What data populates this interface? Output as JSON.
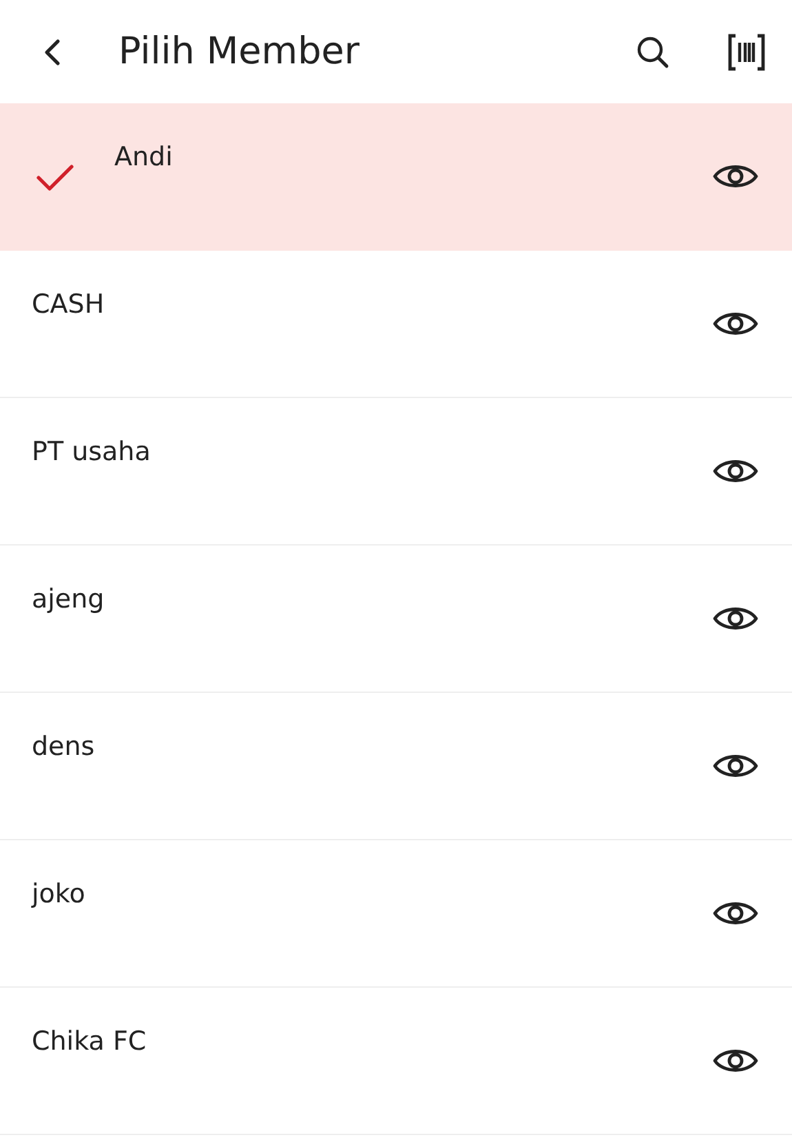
{
  "header": {
    "title": "Pilih Member"
  },
  "members": [
    {
      "name": "Andi",
      "selected": true
    },
    {
      "name": "CASH",
      "selected": false
    },
    {
      "name": "PT usaha",
      "selected": false
    },
    {
      "name": "ajeng",
      "selected": false
    },
    {
      "name": "dens",
      "selected": false
    },
    {
      "name": "joko",
      "selected": false
    },
    {
      "name": "Chika FC",
      "selected": false
    }
  ]
}
